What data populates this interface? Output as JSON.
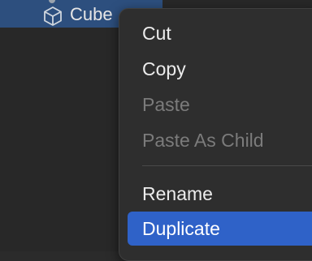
{
  "hierarchy": {
    "selected_item": {
      "label": "Cube",
      "icon": "cube-icon"
    }
  },
  "context_menu": {
    "items": [
      {
        "label": "Cut",
        "enabled": true
      },
      {
        "label": "Copy",
        "enabled": true
      },
      {
        "label": "Paste",
        "enabled": false
      },
      {
        "label": "Paste As Child",
        "enabled": false
      },
      {
        "label": "Rename",
        "enabled": true
      },
      {
        "label": "Duplicate",
        "enabled": true,
        "highlighted": true
      }
    ]
  },
  "colors": {
    "selection_row": "#2d4f7e",
    "menu_highlight": "#2f62c8",
    "disabled_text": "#7b7b7b"
  }
}
